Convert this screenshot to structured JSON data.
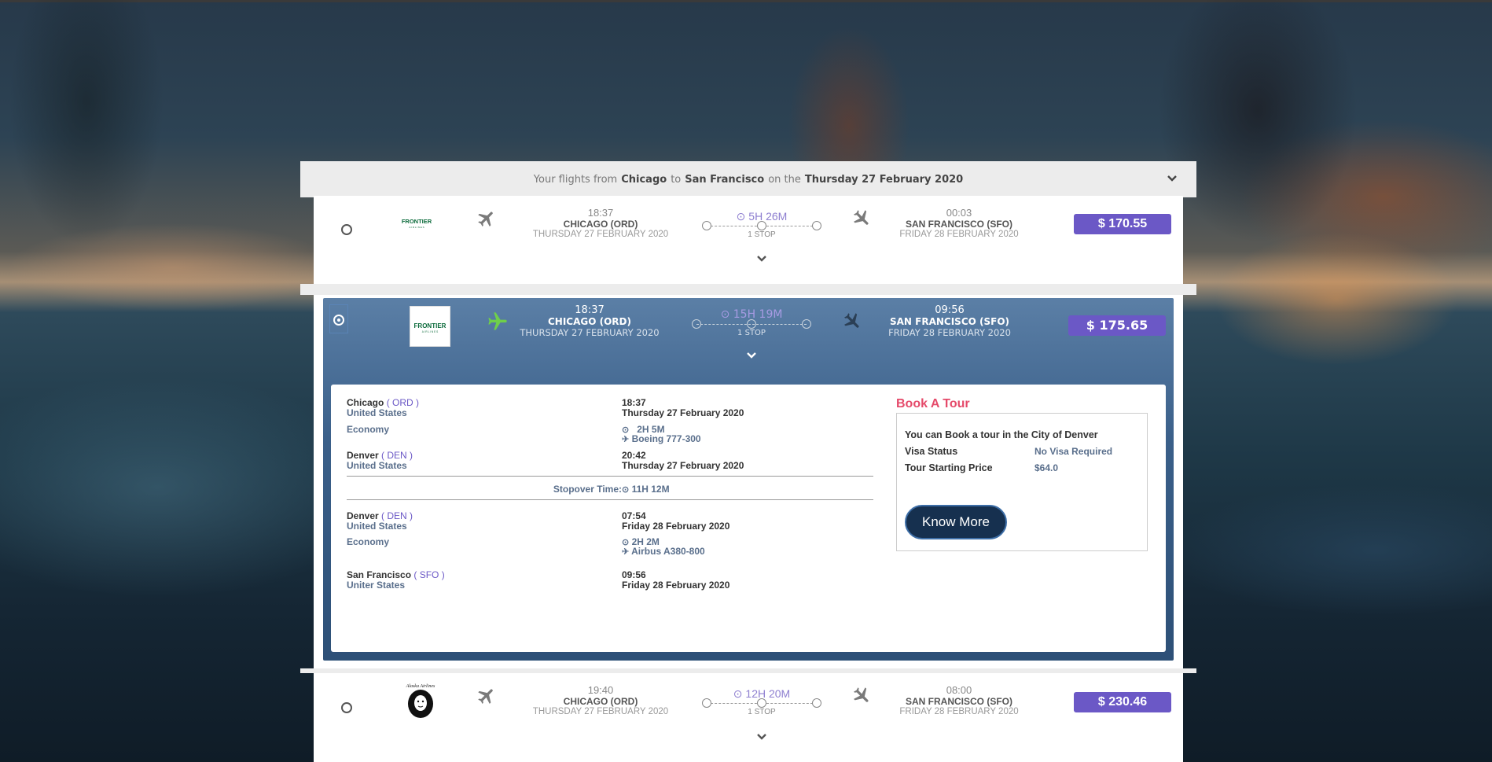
{
  "header": {
    "prefix": "Your flights from",
    "from": "Chicago",
    "to_word": "to",
    "to": "San Francisco",
    "on_word": "on the",
    "date": "Thursday 27 February 2020"
  },
  "flights": [
    {
      "airline": "FRONTIER",
      "dep_time": "18:37",
      "dep_city": "CHICAGO (ORD)",
      "dep_date": "THURSDAY 27 FEBRUARY 2020",
      "duration": "5H 26M",
      "stops": "1 STOP",
      "arr_time": "00:03",
      "arr_city": "SAN FRANCISCO (SFO)",
      "arr_date": "FRIDAY 28 FEBRUARY 2020",
      "price": "$ 170.55"
    },
    {
      "airline": "FRONTIER",
      "dep_time": "18:37",
      "dep_city": "CHICAGO (ORD)",
      "dep_date": "THURSDAY 27 FEBRUARY 2020",
      "duration": "15H 19M",
      "stops": "1 STOP",
      "arr_time": "09:56",
      "arr_city": "SAN FRANCISCO (SFO)",
      "arr_date": "FRIDAY 28 FEBRUARY 2020",
      "price": "$ 175.65"
    },
    {
      "airline": "Alaska Airlines",
      "dep_time": "19:40",
      "dep_city": "CHICAGO (ORD)",
      "dep_date": "THURSDAY 27 FEBRUARY 2020",
      "duration": "12H 20M",
      "stops": "1 STOP",
      "arr_time": "08:00",
      "arr_city": "SAN FRANCISCO (SFO)",
      "arr_date": "FRIDAY 28 FEBRUARY 2020",
      "price": "$ 230.46"
    }
  ],
  "details": {
    "leg1": {
      "from_city": "Chicago",
      "from_code": "( ORD )",
      "from_country": "United States",
      "dep_time": "18:37",
      "dep_date": "Thursday 27 February 2020",
      "cabin": "Economy",
      "duration": "2H 5M",
      "aircraft": "Boeing 777-300",
      "to_city": "Denver",
      "to_code": "( DEN )",
      "to_country": "United States",
      "arr_time": "20:42",
      "arr_date": "Thursday 27 February 2020"
    },
    "stopover": {
      "label": "Stopover Time:",
      "value": "11H 12M"
    },
    "leg2": {
      "from_city": "Denver",
      "from_code": "( DEN )",
      "from_country": "United States",
      "dep_time": "07:54",
      "dep_date": "Friday 28 February 2020",
      "cabin": "Economy",
      "duration": "2H 2M",
      "aircraft": "Airbus A380-800",
      "to_city": "San Francisco",
      "to_code": "( SFO )",
      "to_country": "Uniter States",
      "arr_time": "09:56",
      "arr_date": "Friday 28 February 2020"
    }
  },
  "tour": {
    "title": "Book A Tour",
    "intro": "You can Book a tour in the City of Denver",
    "visa_label": "Visa Status",
    "visa_value": "No Visa Required",
    "price_label": "Tour Starting Price",
    "price_value": "$64.0",
    "button": "Know More"
  },
  "colors": {
    "price_bg": "#6b58c6",
    "accent_pink": "#e54a6a",
    "selected_bg": "#3a5f89",
    "button_bg": "#16304f"
  }
}
